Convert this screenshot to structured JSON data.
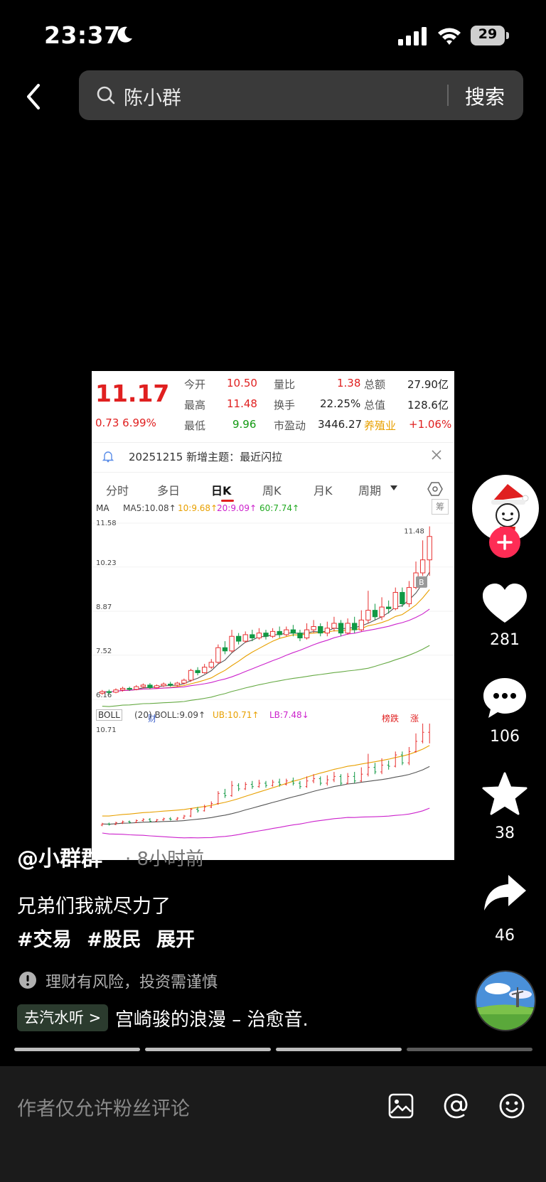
{
  "status_bar": {
    "time": "23:37",
    "battery": "29"
  },
  "search": {
    "query": "陈小群",
    "button": "搜索"
  },
  "stock": {
    "price": "11.17",
    "change": "0.73  6.99%",
    "quotes": [
      {
        "label": "今开",
        "value": "10.50",
        "color": "red"
      },
      {
        "label": "最高",
        "value": "11.48",
        "color": "red"
      },
      {
        "label": "最低",
        "value": "9.96",
        "color": "green"
      }
    ],
    "quotes2": [
      {
        "label": "量比",
        "value": "1.38"
      },
      {
        "label": "换手",
        "value": "22.25%"
      },
      {
        "label": "市盈动",
        "value": "3446.27"
      }
    ],
    "quotes3": [
      {
        "label": "总额",
        "value": "27.90亿"
      },
      {
        "label": "总值",
        "value": "128.6亿"
      },
      {
        "label": "养殖业",
        "value": "+1.06%"
      }
    ],
    "topic": "20251215 新增主题：最近闪拉",
    "tabs": [
      "分时",
      "多日",
      "日K",
      "周K",
      "月K",
      "周期"
    ],
    "ma_label": "MA",
    "ma_items": [
      "MA5:10.08↑",
      "10:9.68↑",
      "20:9.09↑",
      "60:7.74↑"
    ],
    "chou": "筹",
    "boll_label": "BOLL",
    "boll_items": [
      "(20) BOLL:9.09↑",
      "UB:10.71↑",
      "LB:7.48↓"
    ],
    "tag_cai": "财",
    "tag_bang": "榜跌",
    "tag_zhang": "涨",
    "b_marker": "B",
    "high_label": "11.48"
  },
  "chart_data": {
    "type": "candlestick",
    "y_ticks": [
      "11.58",
      "10.23",
      "8.87",
      "7.52",
      "6.16"
    ],
    "boll_tick": "10.71",
    "candles": [
      [
        6.35,
        6.4,
        6.3,
        6.45
      ],
      [
        6.4,
        6.38,
        6.33,
        6.46
      ],
      [
        6.38,
        6.45,
        6.35,
        6.5
      ],
      [
        6.45,
        6.5,
        6.4,
        6.55
      ],
      [
        6.5,
        6.47,
        6.42,
        6.55
      ],
      [
        6.47,
        6.55,
        6.44,
        6.6
      ],
      [
        6.55,
        6.6,
        6.5,
        6.65
      ],
      [
        6.6,
        6.52,
        6.48,
        6.66
      ],
      [
        6.52,
        6.58,
        6.5,
        6.62
      ],
      [
        6.58,
        6.63,
        6.54,
        6.68
      ],
      [
        6.63,
        6.6,
        6.55,
        6.7
      ],
      [
        6.6,
        6.66,
        6.56,
        6.7
      ],
      [
        6.66,
        6.75,
        6.62,
        6.8
      ],
      [
        6.75,
        7.05,
        6.7,
        7.1
      ],
      [
        7.05,
        6.98,
        6.9,
        7.15
      ],
      [
        6.98,
        7.15,
        6.95,
        7.25
      ],
      [
        7.15,
        7.3,
        7.1,
        7.4
      ],
      [
        7.3,
        7.75,
        7.25,
        7.85
      ],
      [
        7.75,
        7.65,
        7.55,
        7.95
      ],
      [
        7.65,
        8.1,
        7.6,
        8.3
      ],
      [
        8.1,
        7.95,
        7.85,
        8.2
      ],
      [
        7.95,
        8.15,
        7.9,
        8.25
      ],
      [
        8.15,
        8.05,
        7.95,
        8.3
      ],
      [
        8.05,
        8.2,
        8.0,
        8.35
      ],
      [
        8.2,
        8.1,
        8.0,
        8.3
      ],
      [
        8.1,
        8.25,
        8.05,
        8.35
      ],
      [
        8.25,
        8.15,
        8.05,
        8.4
      ],
      [
        8.15,
        8.3,
        8.1,
        8.4
      ],
      [
        8.3,
        8.2,
        8.1,
        8.45
      ],
      [
        8.2,
        8.05,
        7.95,
        8.3
      ],
      [
        8.05,
        8.3,
        8.0,
        8.5
      ],
      [
        8.3,
        8.4,
        8.2,
        8.6
      ],
      [
        8.4,
        8.2,
        8.1,
        8.5
      ],
      [
        8.2,
        8.35,
        8.1,
        8.55
      ],
      [
        8.35,
        8.5,
        8.25,
        8.7
      ],
      [
        8.5,
        8.2,
        8.1,
        8.6
      ],
      [
        8.2,
        8.5,
        8.15,
        8.65
      ],
      [
        8.5,
        8.3,
        8.2,
        8.7
      ],
      [
        8.3,
        8.6,
        8.25,
        8.9
      ],
      [
        8.6,
        8.9,
        8.5,
        9.5
      ],
      [
        8.9,
        8.7,
        8.6,
        9.1
      ],
      [
        8.7,
        9.0,
        8.6,
        9.3
      ],
      [
        9.0,
        8.95,
        8.8,
        9.2
      ],
      [
        8.95,
        9.45,
        8.9,
        9.6
      ],
      [
        9.45,
        9.1,
        9.0,
        9.6
      ],
      [
        9.1,
        9.6,
        9.0,
        9.8
      ],
      [
        9.6,
        10.05,
        9.55,
        10.4
      ],
      [
        10.05,
        10.45,
        9.96,
        11.05
      ],
      [
        10.45,
        11.17,
        9.96,
        11.48
      ]
    ]
  },
  "rail": {
    "likes": "281",
    "comments": "106",
    "favorites": "38",
    "shares": "46"
  },
  "post": {
    "author": "@小群群",
    "time_ago": "· 8小时前",
    "description": "兄弟们我就尽力了",
    "tags": [
      "#交易",
      "#股民",
      "展开"
    ],
    "risk": "理财有风险，投资需谨慎",
    "music_chip": "去汽水听 >",
    "music_title": "宫崎骏的浪漫 – 治愈音."
  },
  "comment_bar": {
    "placeholder": "作者仅允许粉丝评论"
  }
}
